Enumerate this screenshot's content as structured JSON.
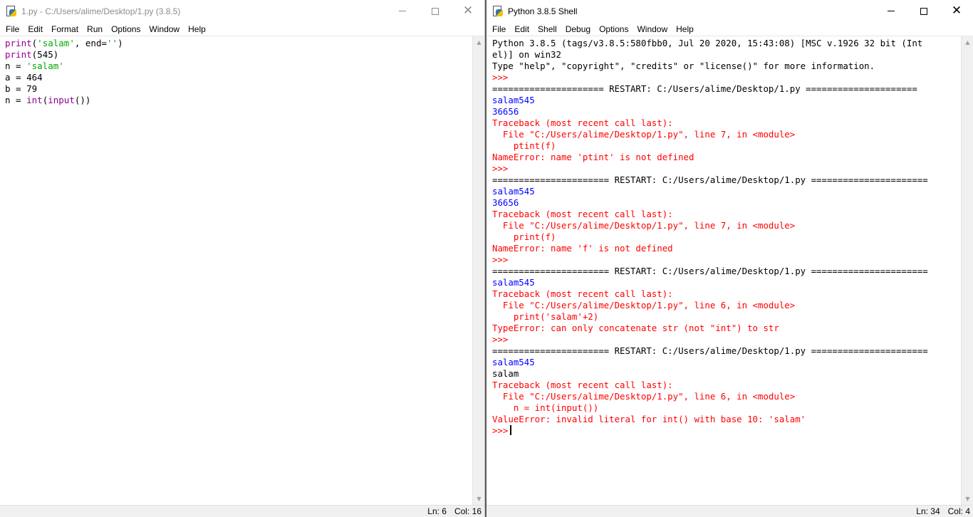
{
  "editor": {
    "title": "1.py - C:/Users/alime/Desktop/1.py (3.8.5)",
    "menu": [
      "File",
      "Edit",
      "Format",
      "Run",
      "Options",
      "Window",
      "Help"
    ],
    "status": {
      "ln": "Ln: 6",
      "col": "Col: 16"
    },
    "code": [
      [
        [
          "print",
          "kw"
        ],
        [
          "(",
          "blk"
        ],
        [
          "'salam'",
          "str"
        ],
        [
          ", end=",
          "blk"
        ],
        [
          "''",
          "str"
        ],
        [
          ")",
          "blk"
        ]
      ],
      [
        [
          "print",
          "kw"
        ],
        [
          "(545)",
          "blk"
        ]
      ],
      [
        [
          "n = ",
          "blk"
        ],
        [
          "'salam'",
          "str"
        ]
      ],
      [
        [
          "a = 464",
          "blk"
        ]
      ],
      [
        [
          "b = 79",
          "blk"
        ]
      ],
      [
        [
          "n = ",
          "blk"
        ],
        [
          "int",
          "kw"
        ],
        [
          "(",
          "blk"
        ],
        [
          "input",
          "kw"
        ],
        [
          "())",
          "blk"
        ]
      ]
    ]
  },
  "shell": {
    "title": "Python 3.8.5 Shell",
    "menu": [
      "File",
      "Edit",
      "Shell",
      "Debug",
      "Options",
      "Window",
      "Help"
    ],
    "status": {
      "ln": "Ln: 34",
      "col": "Col: 4"
    },
    "lines": [
      [
        [
          "Python 3.8.5 (tags/v3.8.5:580fbb0, Jul 20 2020, 15:43:08) [MSC v.1926 32 bit (Int",
          "blk"
        ]
      ],
      [
        [
          "el)] on win32",
          "blk"
        ]
      ],
      [
        [
          "Type \"help\", \"copyright\", \"credits\" or \"license()\" for more information.",
          "blk"
        ]
      ],
      [
        [
          ">>> ",
          "err"
        ]
      ],
      [
        [
          "===================== RESTART: C:/Users/alime/Desktop/1.py =====================",
          "blk"
        ]
      ],
      [
        [
          "salam545",
          "out"
        ]
      ],
      [
        [
          "36656",
          "out"
        ]
      ],
      [
        [
          "Traceback (most recent call last):",
          "err"
        ]
      ],
      [
        [
          "  File \"C:/Users/alime/Desktop/1.py\", line 7, in <module>",
          "err"
        ]
      ],
      [
        [
          "    ptint(f)",
          "err"
        ]
      ],
      [
        [
          "NameError: name 'ptint' is not defined",
          "err"
        ]
      ],
      [
        [
          ">>> ",
          "err"
        ]
      ],
      [
        [
          "====================== RESTART: C:/Users/alime/Desktop/1.py ======================",
          "blk"
        ]
      ],
      [
        [
          "salam545",
          "out"
        ]
      ],
      [
        [
          "36656",
          "out"
        ]
      ],
      [
        [
          "Traceback (most recent call last):",
          "err"
        ]
      ],
      [
        [
          "  File \"C:/Users/alime/Desktop/1.py\", line 7, in <module>",
          "err"
        ]
      ],
      [
        [
          "    print(f)",
          "err"
        ]
      ],
      [
        [
          "NameError: name 'f' is not defined",
          "err"
        ]
      ],
      [
        [
          ">>> ",
          "err"
        ]
      ],
      [
        [
          "====================== RESTART: C:/Users/alime/Desktop/1.py ======================",
          "blk"
        ]
      ],
      [
        [
          "salam545",
          "out"
        ]
      ],
      [
        [
          "Traceback (most recent call last):",
          "err"
        ]
      ],
      [
        [
          "  File \"C:/Users/alime/Desktop/1.py\", line 6, in <module>",
          "err"
        ]
      ],
      [
        [
          "    print('salam'+2)",
          "err"
        ]
      ],
      [
        [
          "TypeError: can only concatenate str (not \"int\") to str",
          "err"
        ]
      ],
      [
        [
          ">>> ",
          "err"
        ]
      ],
      [
        [
          "====================== RESTART: C:/Users/alime/Desktop/1.py ======================",
          "blk"
        ]
      ],
      [
        [
          "salam545",
          "out"
        ]
      ],
      [
        [
          "salam",
          "blk"
        ]
      ],
      [
        [
          "Traceback (most recent call last):",
          "err"
        ]
      ],
      [
        [
          "  File \"C:/Users/alime/Desktop/1.py\", line 6, in <module>",
          "err"
        ]
      ],
      [
        [
          "    n = int(input())",
          "err"
        ]
      ],
      [
        [
          "ValueError: invalid literal for int() with base 10: 'salam'",
          "err"
        ]
      ],
      [
        [
          ">>>",
          "err"
        ]
      ]
    ]
  },
  "icons": {
    "app": "python-idle-icon",
    "minimize": "minimize-icon",
    "maximize": "maximize-icon",
    "close": "close-icon"
  },
  "colors": {
    "keyword": "#900090",
    "string": "#00aa00",
    "stdout": "#0000ff",
    "stderr": "#ff0000"
  }
}
